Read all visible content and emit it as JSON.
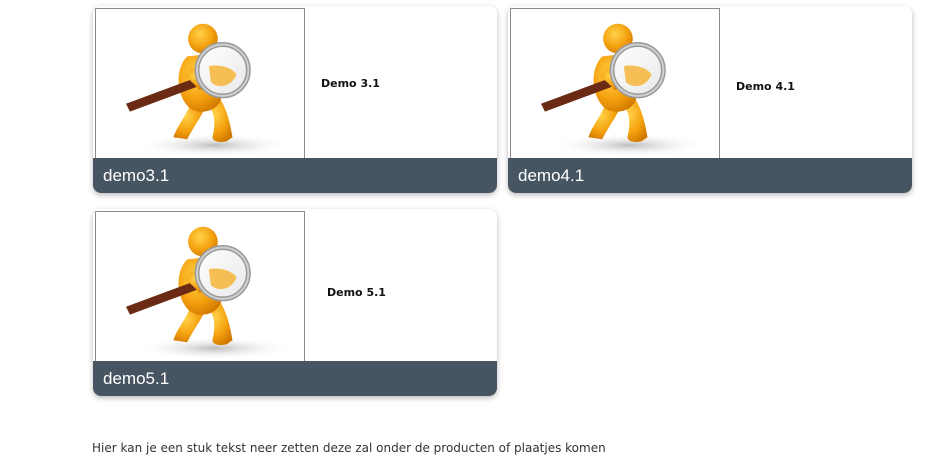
{
  "products": [
    {
      "image_icon": "person-with-magnifying-glass",
      "description": "Demo 3.1",
      "caption": "demo3.1"
    },
    {
      "image_icon": "person-with-magnifying-glass",
      "description": "Demo 4.1",
      "caption": "demo4.1"
    },
    {
      "image_icon": "person-with-magnifying-glass",
      "description": "Demo 5.1",
      "caption": "demo5.1"
    }
  ],
  "footer": {
    "text": "Hier kan je een stuk tekst neer zetten deze zal onder de producten of plaatjes komen"
  },
  "colors": {
    "caption_bar": "#475462",
    "figure_orange": "#f5a20f",
    "handle_brown": "#6b2a14"
  }
}
